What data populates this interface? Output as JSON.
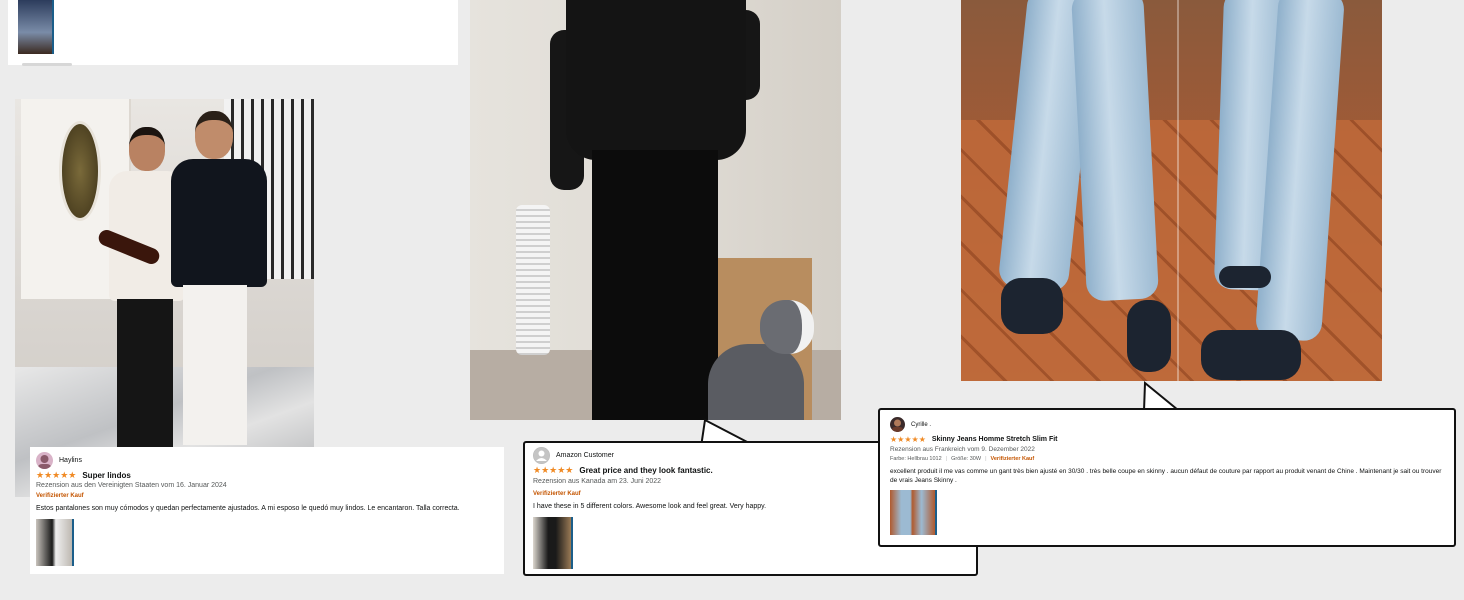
{
  "reviews": [
    {
      "name": "Haylins",
      "stars": "★★★★★",
      "title": "Super lindos",
      "meta": "Rezension aus den Vereinigten Staaten vom 16. Januar 2024",
      "verified": "Verifizierter Kauf",
      "body": "Estos pantalones son muy cómodos y quedan perfectamente ajustados. A mi esposo le quedó muy lindos. Le encantaron. Talla correcta."
    },
    {
      "name": "Amazon Customer",
      "stars": "★★★★★",
      "title": "Great price and they look fantastic.",
      "meta": "Rezension aus Kanada am 23. Juni 2022",
      "verified": "Verifizierter Kauf",
      "body": "I have these in 5 different colors. Awesome look and feel great. Very happy."
    },
    {
      "name": "Cyrille .",
      "stars": "★★★★★",
      "title": "Skinny Jeans Homme Stretch Slim Fit",
      "meta": "Rezension aus Frankreich vom 9. Dezember 2022",
      "color": "Farbe: Hellbrau 1012",
      "size": "Größe: 30W",
      "verified": "Verifizierter Kauf",
      "body": "excellent produit il me vas comme un gant très bien ajusté en 30/30 . très belle coupe en skinny . aucun défaut de couture par rapport au produit venant de Chine . Maintenant je sait ou trouver de vrais Jeans Skinny ."
    }
  ],
  "colors": {
    "star": "#f08a24",
    "verified": "#c45500",
    "background": "#ececec"
  },
  "icons": {
    "avatar": "avatar-icon",
    "thumbnail": "review-image-thumbnail"
  }
}
